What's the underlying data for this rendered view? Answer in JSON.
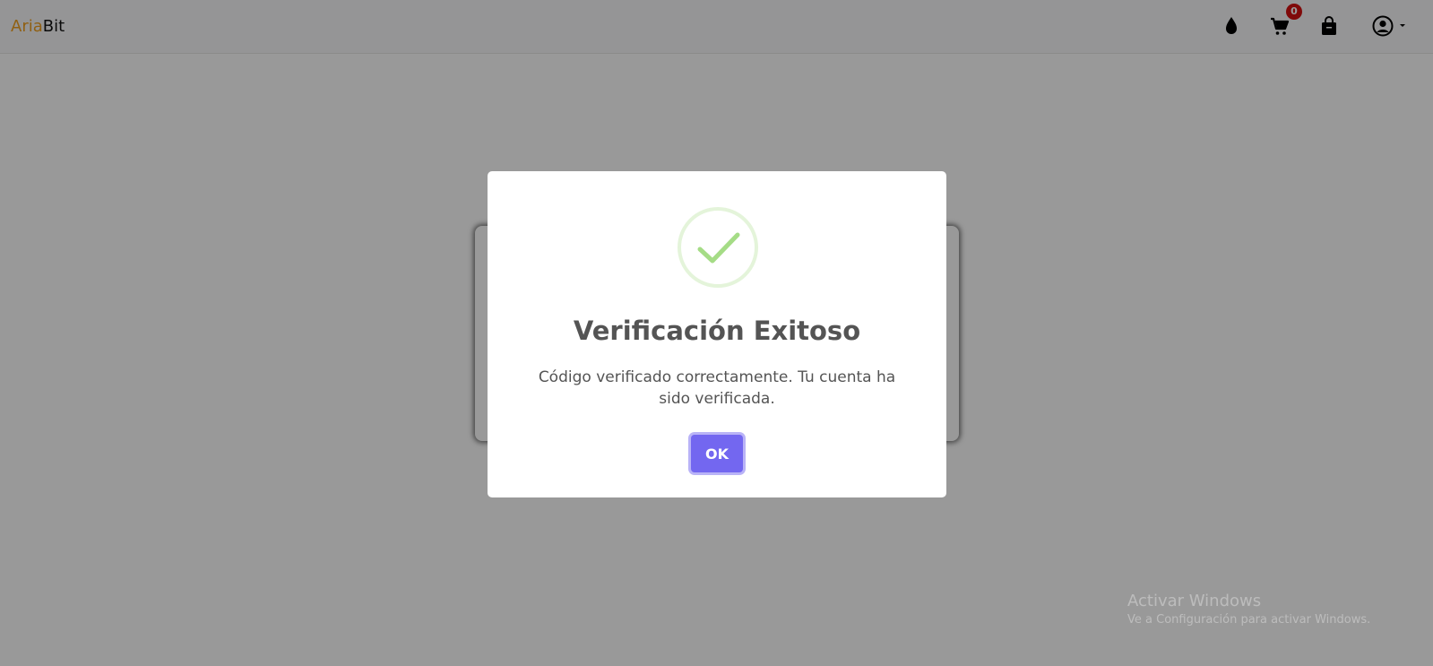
{
  "navbar": {
    "brand_part1": "Aria",
    "brand_part2": "Bit",
    "cart_count": "0",
    "icons": [
      "drop-icon",
      "cart-icon",
      "shopping-bag-icon",
      "user-circle-icon",
      "caret-down-icon"
    ]
  },
  "dialog": {
    "title": "Verificación Exitoso",
    "message": "Código verificado correctamente. Tu cuenta ha sido verificada.",
    "ok_label": "OK",
    "icon": "success-check-icon",
    "accent_color": "#7367f0",
    "success_color": "#a5dc86"
  },
  "watermark": {
    "line1": "Activar Windows",
    "line2": "Ve a Configuración para activar Windows."
  }
}
